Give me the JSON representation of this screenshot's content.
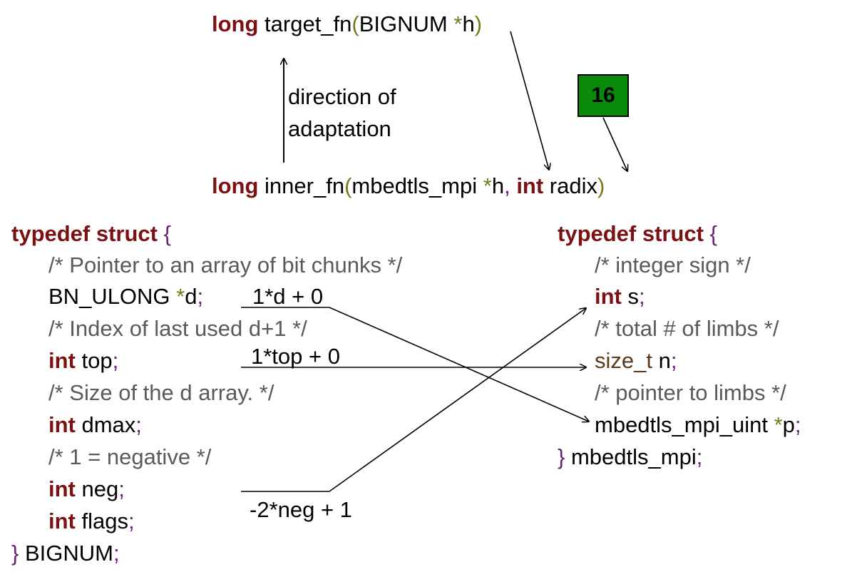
{
  "signatures": {
    "target": {
      "kw": "long",
      "name": " target_fn",
      "open": "(",
      "type": "BIGNUM ",
      "star": "*",
      "param": "h",
      "close": ")"
    },
    "inner": {
      "kw": "long",
      "name": " inner_fn",
      "open": "(",
      "type": "mbedtls_mpi ",
      "star": "*",
      "param": "h",
      "comma": ", ",
      "kw2": "int",
      "param2": " radix",
      "close": ")"
    }
  },
  "annotation": {
    "line1": "direction of",
    "line2": "adaptation"
  },
  "constant_box": {
    "value": "16",
    "color": "#0a8a0a"
  },
  "bignum_struct": {
    "typedef": "typedef struct",
    "brace_open": " {",
    "comment_d": " /* Pointer to an array of bit chunks */",
    "d_type": "BN_ULONG ",
    "d_star": "*",
    "d_name": "d",
    "d_semi": ";",
    "comment_top": "/* Index of last used d+1 */",
    "top_kw": "int",
    "top_name": " top",
    "top_semi": ";",
    "comment_dmax": "/* Size of the d array. */",
    "dmax_kw": "int",
    "dmax_name": " dmax",
    "dmax_semi": ";",
    "comment_neg": "/* 1 = negative */",
    "neg_kw": "int",
    "neg_name": " neg",
    "neg_semi": ";",
    "flags_kw": "int",
    "flags_name": " flags",
    "flags_semi": ";",
    "brace_close": "}",
    "name": " BIGNUM",
    "semi": ";"
  },
  "mpi_struct": {
    "typedef": "typedef struct",
    "brace_open": " {",
    "comment_s": "/* integer sign */",
    "s_kw": "int",
    "s_name": " s",
    "s_semi": ";",
    "comment_n": "/* total # of limbs */",
    "n_type": "size_t",
    "n_name": " n",
    "n_semi": ";",
    "comment_p": "/* pointer to limbs */",
    "p_type": "mbedtls_mpi_uint ",
    "p_star": "*",
    "p_name": "p",
    "p_semi": ";",
    "brace_close": "}",
    "name": " mbedtls_mpi",
    "semi": ";"
  },
  "mappings": {
    "d_to_p": "1*d + 0",
    "top_to_n": "1*top + 0",
    "neg_to_s": "-2*neg + 1"
  },
  "colors": {
    "keyword": "#7b1113",
    "punct": "#6a1f7a",
    "star": "#7a7a1a",
    "comment": "#5a5a5a",
    "type": "#5a3a1a"
  }
}
